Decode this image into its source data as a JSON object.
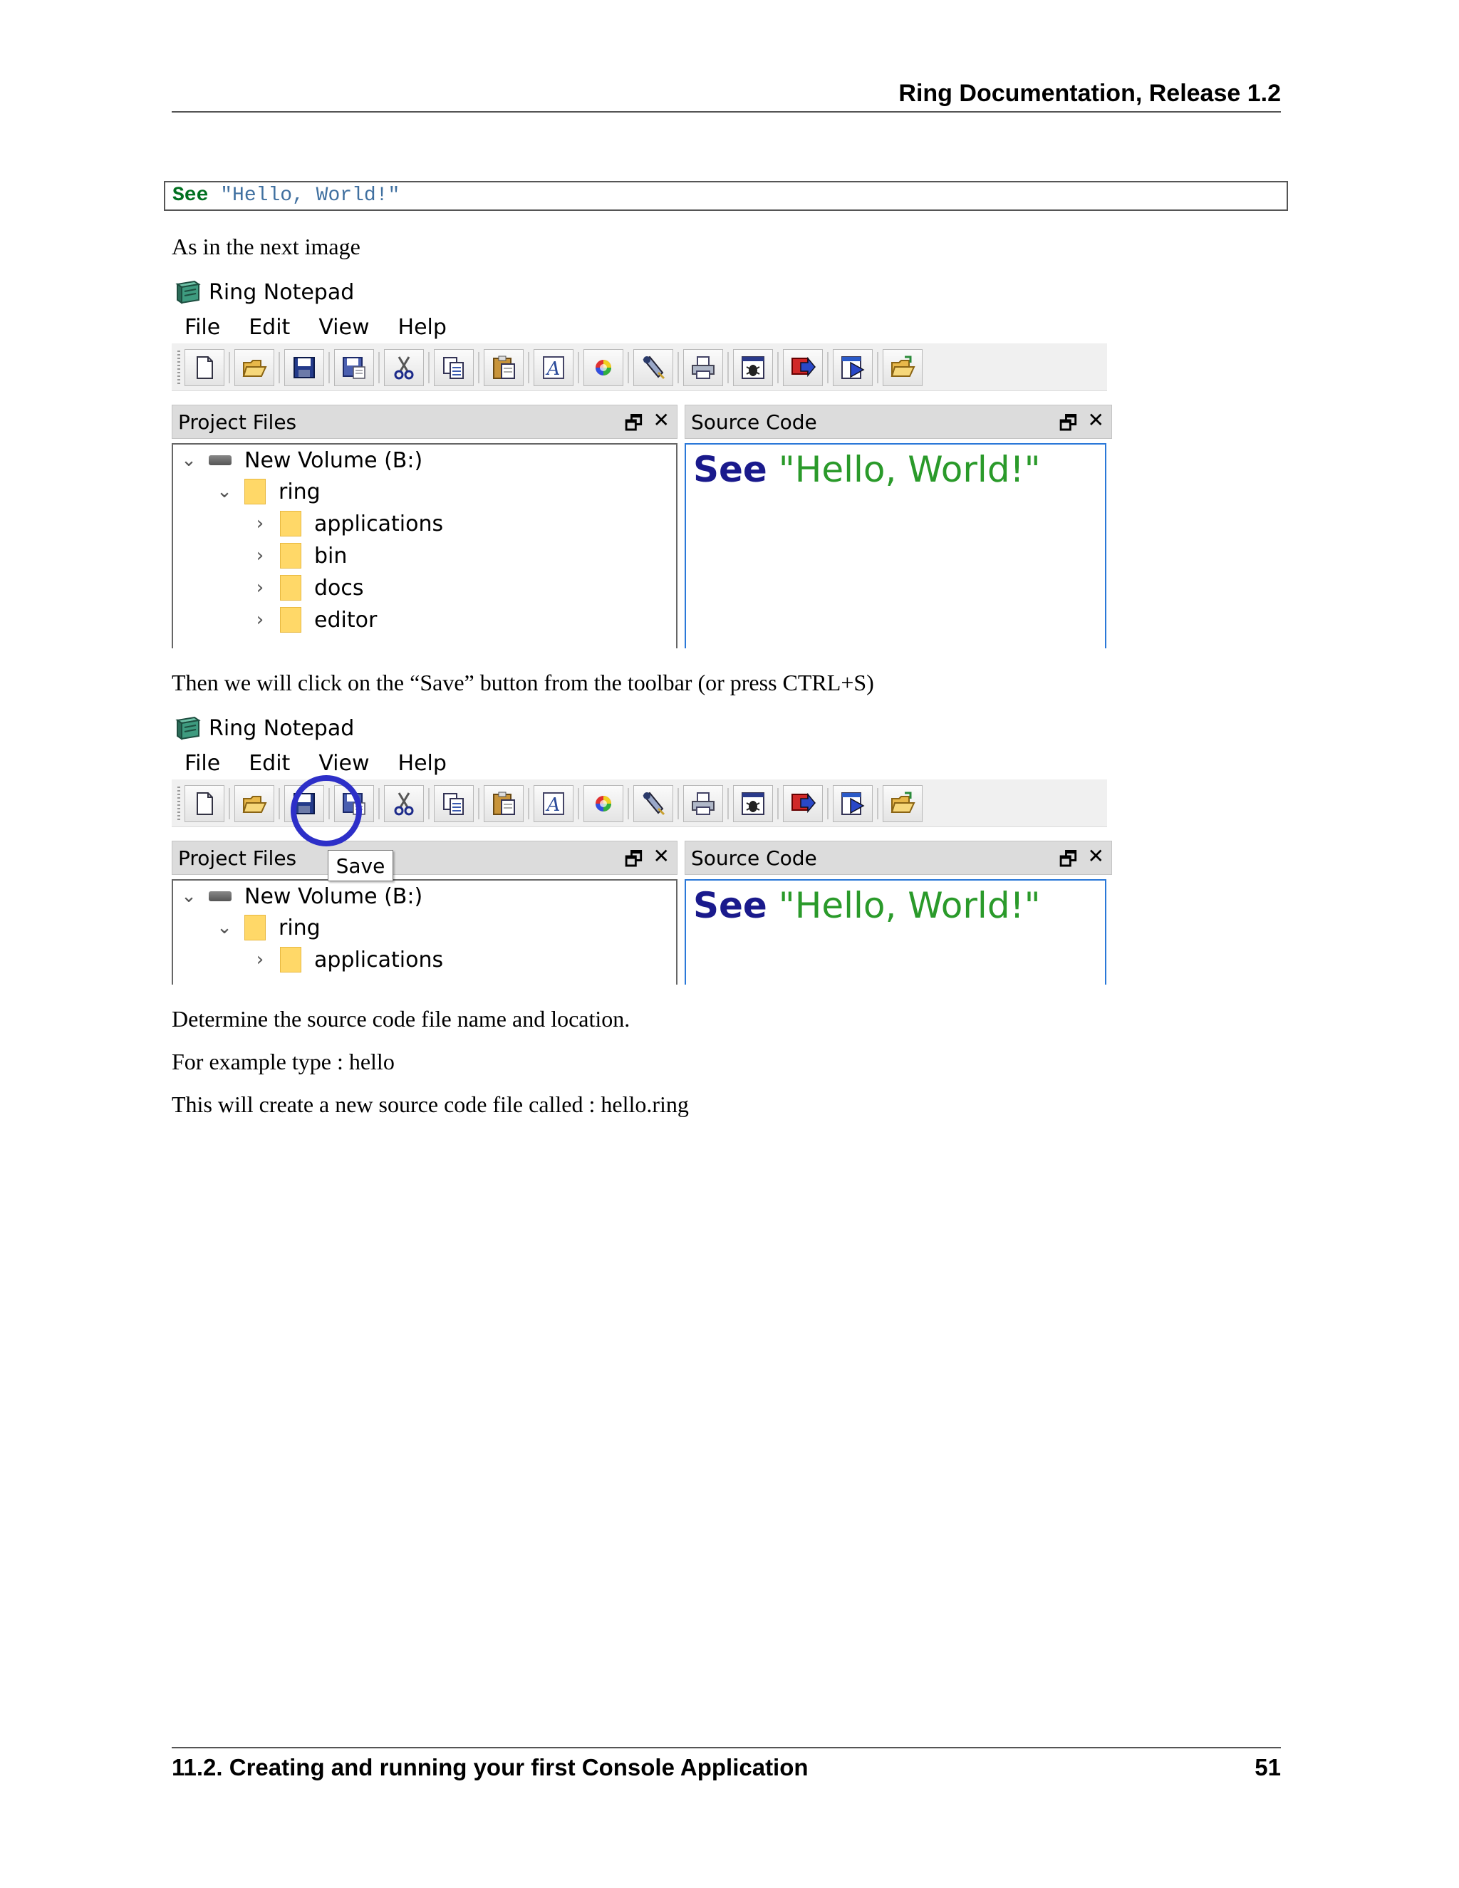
{
  "header": {
    "title": "Ring Documentation, Release 1.2"
  },
  "code_block": {
    "keyword": "See",
    "string": "\"Hello, World!\""
  },
  "paragraphs": {
    "p1": "As in the next image",
    "p2": "Then we will click on the “Save” button from the toolbar (or press CTRL+S)",
    "p3": "Determine the source code file name and location.",
    "p4": "For example type : hello",
    "p5": "This will create a new source code file called : hello.ring"
  },
  "app": {
    "title": "Ring Notepad",
    "menu": [
      "File",
      "Edit",
      "View",
      "Help"
    ],
    "toolbar_icons": [
      "new-file-icon",
      "open-folder-icon",
      "save-icon",
      "save-as-icon",
      "cut-icon",
      "copy-icon",
      "paste-icon",
      "font-icon",
      "color-icon",
      "tools-icon",
      "print-icon",
      "debug-icon",
      "run-icon",
      "run-no-console-icon",
      "open-project-icon"
    ],
    "left_dock_title": "Project Files",
    "right_dock_title": "Source Code",
    "dock_float_glyph": "🗗",
    "dock_close_glyph": "✕",
    "tree": [
      {
        "label": "New Volume (B:)",
        "type": "drive",
        "expanded": true
      },
      {
        "label": "ring",
        "type": "folder",
        "expanded": true
      },
      {
        "label": "applications",
        "type": "folder",
        "expanded": false
      },
      {
        "label": "bin",
        "type": "folder",
        "expanded": false
      },
      {
        "label": "docs",
        "type": "folder",
        "expanded": false
      },
      {
        "label": "editor",
        "type": "folder",
        "expanded": false
      }
    ],
    "code": {
      "keyword": "See",
      "string": "\"Hello, World!\""
    },
    "tooltip": "Save"
  },
  "footer": {
    "section": "11.2.  Creating and running your first Console Application",
    "page": "51"
  }
}
